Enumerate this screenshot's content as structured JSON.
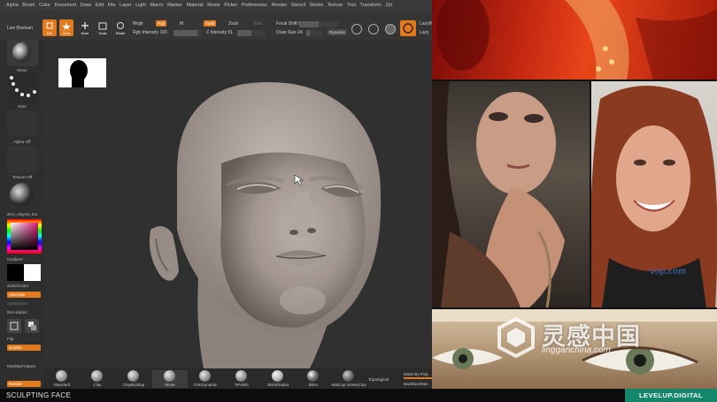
{
  "menubar": [
    "Alpha",
    "Brush",
    "Color",
    "Document",
    "Draw",
    "Edit",
    "File",
    "Layer",
    "Light",
    "Macro",
    "Marker",
    "Material",
    "Movie",
    "Picker",
    "Preferences",
    "Render",
    "Stencil",
    "Stroke",
    "Texture",
    "Tool",
    "Transform",
    "Zpl"
  ],
  "shelf": {
    "live_boolean": "Live Boolean",
    "edit_label": "Edit",
    "draw_label": "Draw",
    "move_label": "Move",
    "scale_label": "Scale",
    "rotate_label": "Rotate",
    "mrgb": "Mrgb",
    "rgb": "Rgb",
    "m": "M",
    "rgb_intensity": "Rgb Intensity 100",
    "zadd": "Zadd",
    "zsub": "Zsub",
    "zcut": "Zcut",
    "z_intensity": "Z Intensity 51",
    "focal_shift": "Focal Shift 0",
    "draw_size": "Draw Size 24",
    "dynamic": "Dynamic",
    "lazy": "LazyM",
    "lazy2": "Lazy"
  },
  "leftpanel": {
    "move": "Move",
    "dots": "Dots",
    "alpha_off": "Alpha Off",
    "texture_off": "Texture Off",
    "material": "doro_clayset_t01",
    "gradient": "Gradient",
    "switch_color": "SwitchColor",
    "alternate": "Alternate",
    "split_hidden": "SplitHidden",
    "del_hidden": "Del Hidden",
    "flip": "Flip",
    "double": "Double",
    "mask_by_feature": "MaskByFeature",
    "render": "Render"
  },
  "brushes": [
    "Standard",
    "Clay",
    "ClayBuildup",
    "Move",
    "TrimDynamic",
    "hPolish",
    "SkinShade4",
    "Blinn",
    "MatCap GreenClay"
  ],
  "brushbar": {
    "topological": "Topological",
    "mask_by_poly": "Mask By Poly",
    "backface_mask": "BackfaceMas"
  },
  "bottombar": {
    "title": "SCULPTING FACE",
    "brand": "LEVELUP.DIGITAL"
  },
  "watermark": {
    "main": "灵感中国",
    "sub": "lingganchina.com",
    "reference_text": "vop.com"
  },
  "colors": {
    "accent": "#e07a1c",
    "brand": "#14866b",
    "background": "#303030"
  }
}
